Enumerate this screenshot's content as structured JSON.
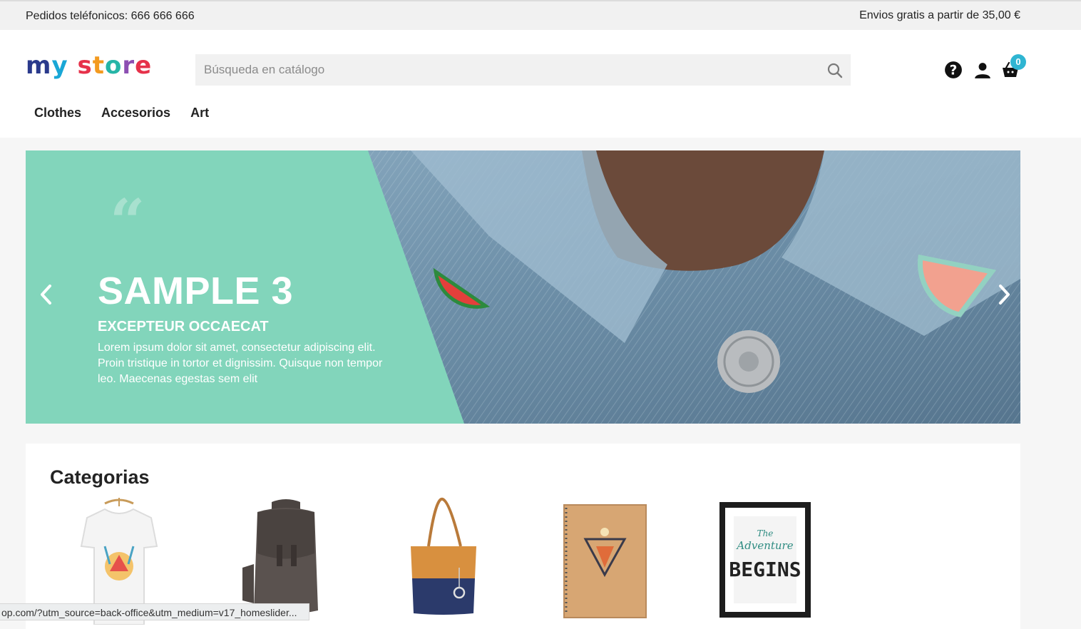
{
  "topbar": {
    "phone": "Pedidos teléfonicos: 666 666 666",
    "shipping": "Envios gratis a partir de 35,00 €"
  },
  "header": {
    "logo_text": "my store",
    "search_placeholder": "Búsqueda en catálogo",
    "cart_count": "0",
    "icons": [
      "help-icon",
      "user-icon",
      "cart-icon",
      "search-icon"
    ]
  },
  "nav": {
    "items": [
      "Clothes",
      "Accesorios",
      "Art"
    ]
  },
  "slider": {
    "quote_mark": "“",
    "title": "SAMPLE 3",
    "subtitle": "EXCEPTEUR OCCAECAT",
    "text": "Lorem ipsum dolor sit amet, consectetur adipiscing elit. Proin tristique in tortor et dignissim. Quisque non tempor leo. Maecenas egestas sem elit",
    "panel_color": "#82d5bb"
  },
  "categories": {
    "heading": "Categorias",
    "items": [
      "t-shirt",
      "backpack",
      "tote-bag",
      "notebook",
      "framed-poster"
    ],
    "poster_text": [
      "The",
      "Adventure",
      "BEGINS"
    ]
  },
  "status_bar": {
    "url": "op.com/?utm_source=back-office&utm_medium=v17_homeslider..."
  }
}
